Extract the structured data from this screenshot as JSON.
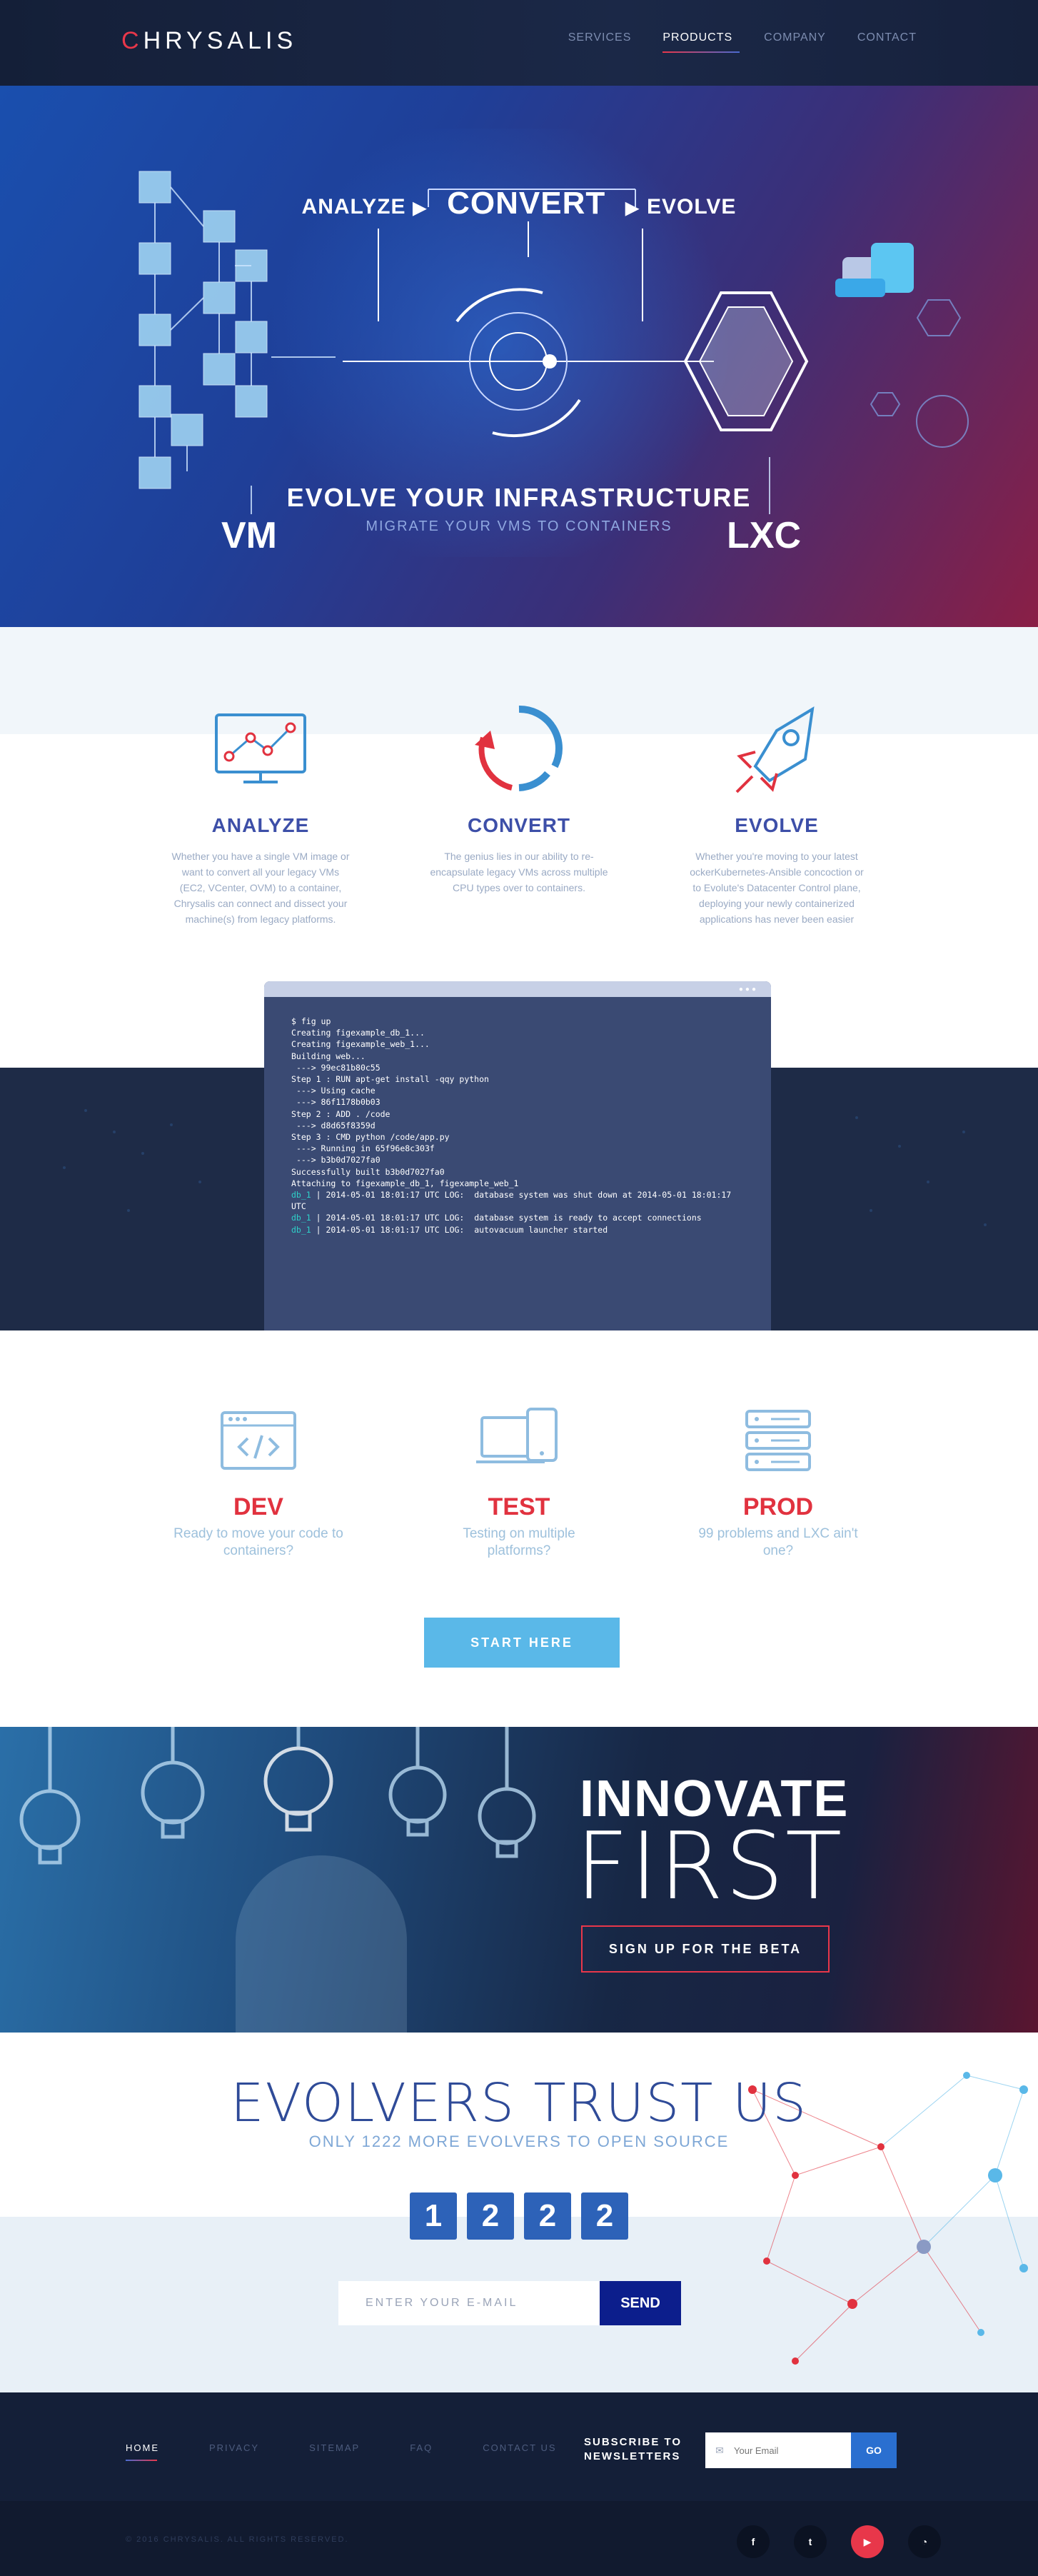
{
  "nav": {
    "logo": "CHRYSALIS",
    "links": [
      "SERVICES",
      "PRODUCTS",
      "COMPANY",
      "CONTACT"
    ],
    "active": "PRODUCTS"
  },
  "hero": {
    "flow": [
      "ANALYZE",
      "CONVERT",
      "EVOLVE"
    ],
    "title": "EVOLVE YOUR INFRASTRUCTURE",
    "subtitle": "MIGRATE YOUR VMS TO CONTAINERS",
    "left_label": "VM",
    "right_label": "LXC"
  },
  "features": [
    {
      "title": "ANALYZE",
      "icon": "chart-monitor-icon",
      "text": "Whether you have a single VM image or want to convert all your legacy VMs (EC2, VCenter, OVM) to a container, Chrysalis can connect and dissect your machine(s) from legacy platforms."
    },
    {
      "title": "CONVERT",
      "icon": "convert-cycle-icon",
      "text": "The genius lies in our ability to re-encapsulate legacy VMs across multiple CPU types over to containers."
    },
    {
      "title": "EVOLVE",
      "icon": "rocket-icon",
      "text": "Whether you're moving to your latest ockerKubernetes-Ansible concoction or to Evolute's Datacenter Control plane, deploying your newly containerized applications has never been easier"
    }
  ],
  "terminal": {
    "lines": [
      "$ fig up",
      "Creating figexample_db_1...",
      "Creating figexample_web_1...",
      "Building web...",
      " ---> 99ec81b80c55",
      "Step 1 : RUN apt-get install -qqy python",
      " ---> Using cache",
      " ---> 86f1178b0b03",
      "Step 2 : ADD . /code",
      " ---> d8d65f8359d",
      "Step 3 : CMD python /code/app.py",
      " ---> Running in 65f96e8c303f",
      " ---> b3b0d7027fa0",
      "Successfully built b3b0d7027fa0",
      "Attaching to figexample_db_1, figexample_web_1"
    ],
    "log": [
      {
        "src": "db_1",
        "msg": "| 2014-05-01 18:01:17 UTC LOG:  database system was shut down at 2014-05-01 18:01:17 UTC"
      },
      {
        "src": "db_1",
        "msg": "| 2014-05-01 18:01:17 UTC LOG:  database system is ready to accept connections"
      },
      {
        "src": "db_1",
        "msg": "| 2014-05-01 18:01:17 UTC LOG:  autovacuum launcher started"
      }
    ]
  },
  "stages": [
    {
      "title": "DEV",
      "icon": "code-window-icon",
      "text": "Ready to move your code to containers?"
    },
    {
      "title": "TEST",
      "icon": "devices-icon",
      "text": "Testing on multiple platforms?"
    },
    {
      "title": "PROD",
      "icon": "server-stack-icon",
      "text": "99 problems and LXC ain't one?"
    }
  ],
  "start_button": "START HERE",
  "innovate": {
    "line1": "INNOVATE",
    "line2": "FIRST",
    "button": "SIGN UP FOR THE BETA"
  },
  "trust": {
    "title": "EVOLVERS TRUST US",
    "subtitle": "ONLY 1222 MORE EVOLVERS TO OPEN SOURCE",
    "digits": [
      "1",
      "2",
      "2",
      "2"
    ],
    "email_placeholder": "ENTER YOUR E-MAIL",
    "send": "SEND"
  },
  "footer": {
    "links": [
      "HOME",
      "PRIVACY",
      "SITEMAP",
      "FAQ",
      "CONTACT US"
    ],
    "active": "HOME",
    "subscribe_line1": "SUBSCRIBE TO",
    "subscribe_line2": "NEWSLETTERS",
    "email_placeholder": "Your Email",
    "go": "GO",
    "copyright": "© 2016 CHRYSALIS. ALL RIGHTS RESERVED.",
    "socials": [
      {
        "name": "facebook-icon",
        "glyph": "f"
      },
      {
        "name": "twitter-icon",
        "glyph": "t"
      },
      {
        "name": "youtube-icon",
        "glyph": "▶"
      },
      {
        "name": "rss-icon",
        "glyph": "◔"
      }
    ]
  },
  "colors": {
    "accent_red": "#e1323f",
    "brand_blue": "#2d62b8",
    "nav_bg": "#141f38",
    "cta_blue": "#5ab8e8"
  }
}
